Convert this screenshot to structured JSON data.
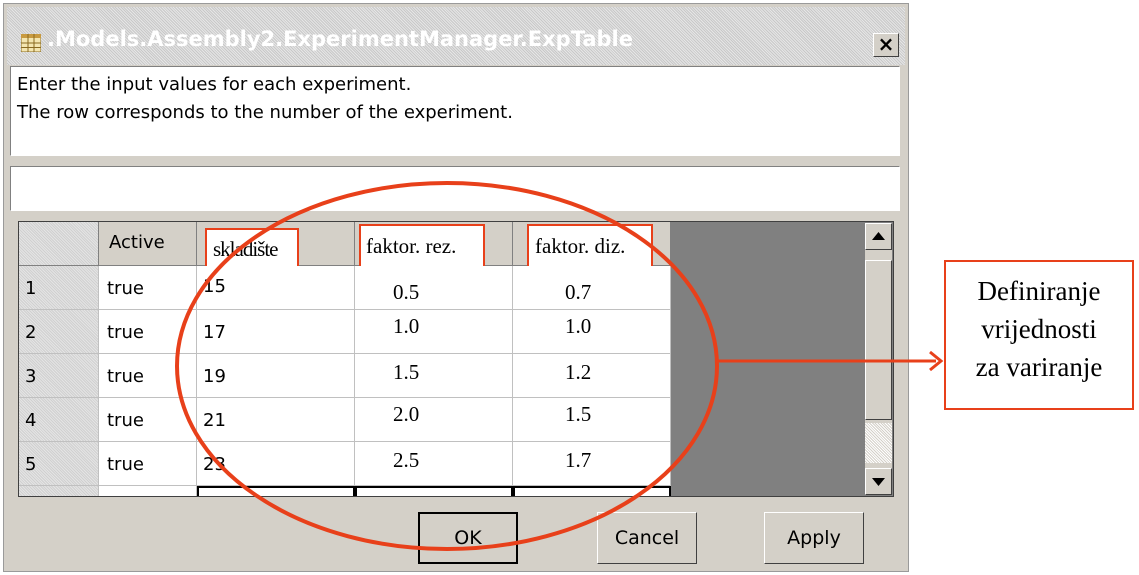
{
  "window": {
    "title": ".Models.Assembly2.ExperimentManager.ExpTable",
    "close_label": "×"
  },
  "description": {
    "line1": "Enter the input values for each experiment.",
    "line2": "The row corresponds to the number of the experiment."
  },
  "table": {
    "columns": [
      "Active",
      "skladište",
      "faktor. rez.",
      "faktor. diz."
    ],
    "rows": [
      {
        "num": "1",
        "active": "true",
        "skladiste": "15",
        "faktor_rez": "0.5",
        "faktor_diz": "0.7"
      },
      {
        "num": "2",
        "active": "true",
        "skladiste": "17",
        "faktor_rez": "1.0",
        "faktor_diz": "1.0"
      },
      {
        "num": "3",
        "active": "true",
        "skladiste": "19",
        "faktor_rez": "1.5",
        "faktor_diz": "1.2"
      },
      {
        "num": "4",
        "active": "true",
        "skladiste": "21",
        "faktor_rez": "2.0",
        "faktor_diz": "1.5"
      },
      {
        "num": "5",
        "active": "true",
        "skladiste": "23",
        "faktor_rez": "2.5",
        "faktor_diz": "1.7"
      }
    ]
  },
  "buttons": {
    "ok": "OK",
    "cancel": "Cancel",
    "apply": "Apply"
  },
  "annotation": {
    "line1": "Definiranje",
    "line2": "vrijednosti",
    "line3": "za variranje",
    "color": "#e8401a"
  },
  "icons": {
    "title_icon": "table-icon",
    "scroll_up": "arrow-up-icon",
    "scroll_down": "arrow-down-icon"
  }
}
